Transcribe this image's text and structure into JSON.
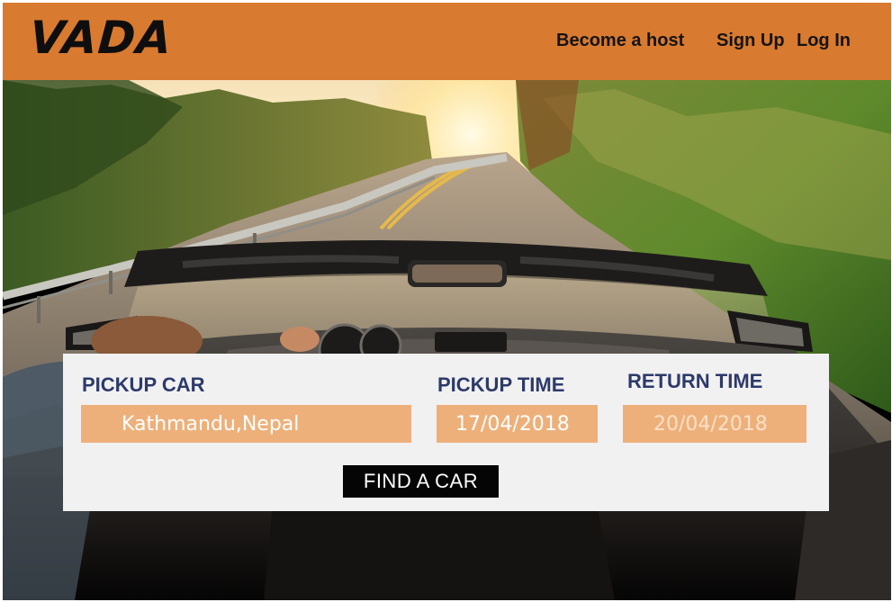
{
  "header": {
    "logo": "VADA",
    "nav": {
      "become_host": "Become a host",
      "sign_up": "Sign Up",
      "log_in": "Log In"
    },
    "background_color": "#d87a2f"
  },
  "hero": {
    "image_alt": "convertible car driving on a sunlit country road"
  },
  "search": {
    "pickup_car_label": "PICKUP CAR",
    "pickup_car_value": "Kathmandu,Nepal",
    "pickup_time_label": "PICKUP TIME",
    "pickup_time_value": "17/04/2018",
    "return_time_label": "RETURN TIME",
    "return_time_value": "20/04/2018",
    "find_button": "FIND A CAR",
    "label_color": "#2d3a6a",
    "field_color": "#eeb07a"
  }
}
